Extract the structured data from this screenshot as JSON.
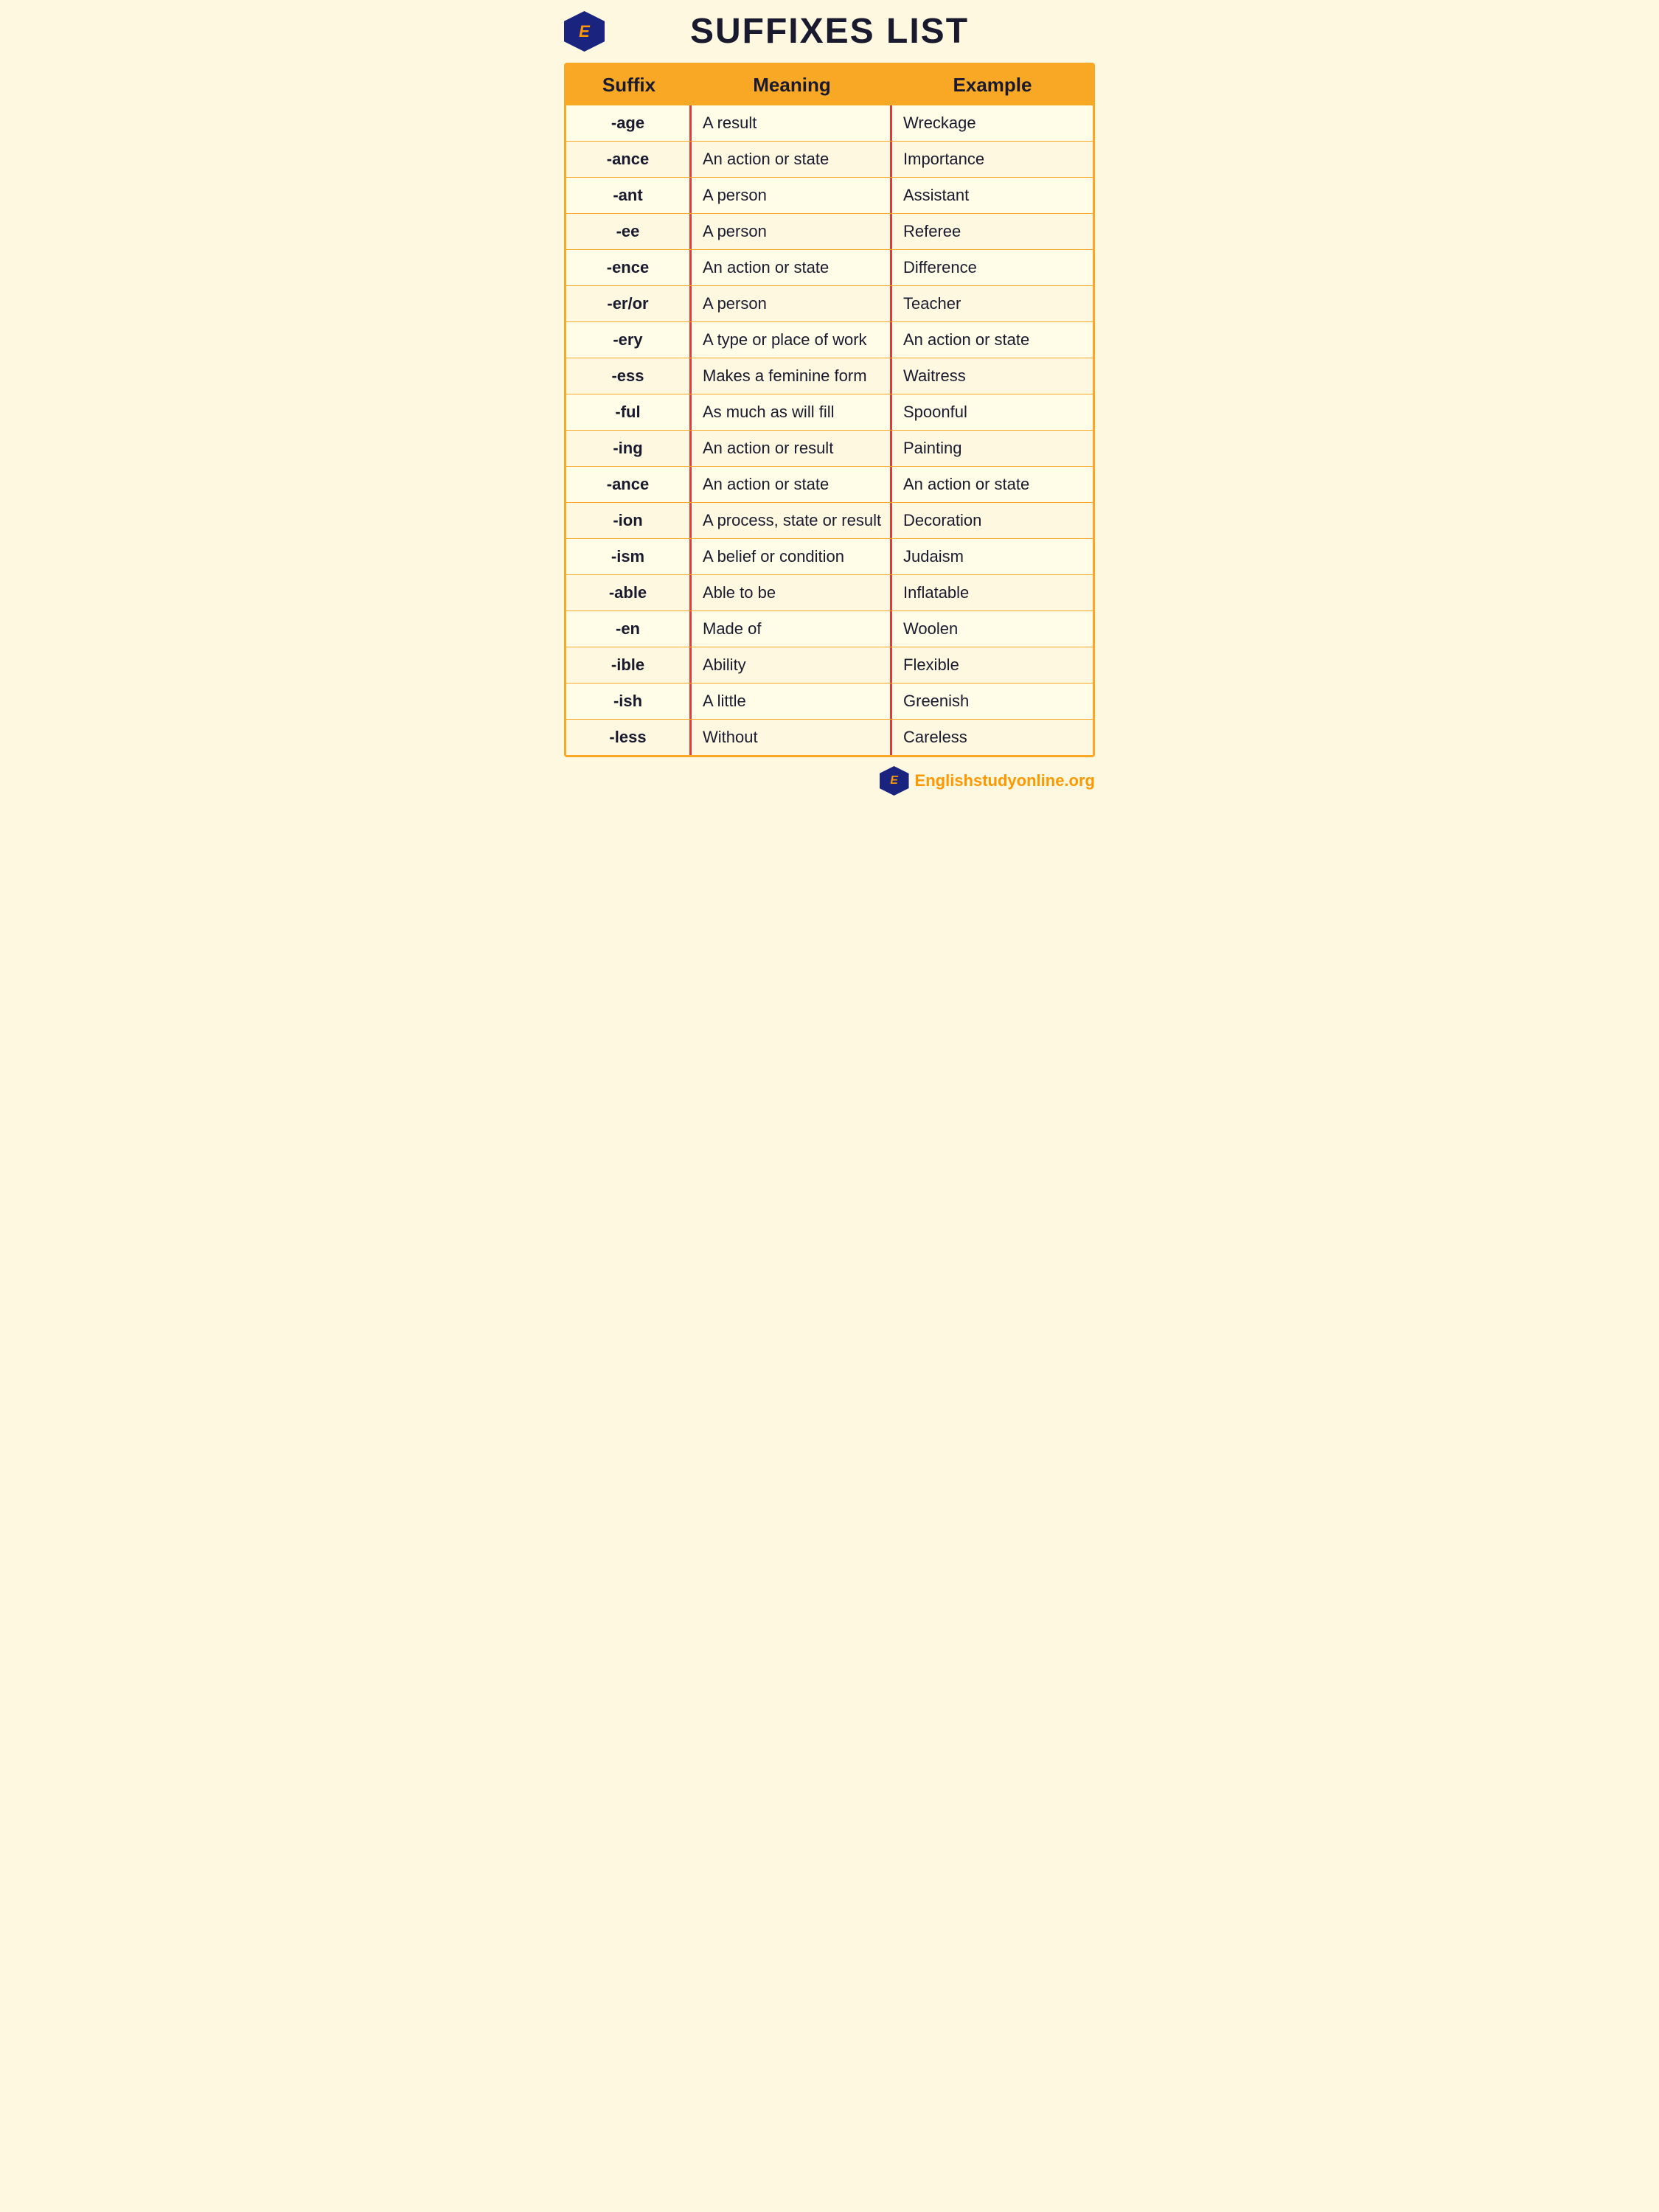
{
  "page": {
    "title": "SUFFIXES LIST",
    "logo_letter": "E",
    "footer_site": "nglishstudyonline.org",
    "footer_prefix": "E"
  },
  "table": {
    "headers": [
      "Suffix",
      "Meaning",
      "Example"
    ],
    "rows": [
      {
        "suffix": "-age",
        "meaning": "A result",
        "example": "Wreckage",
        "row_class": "even"
      },
      {
        "suffix": "-ance",
        "meaning": "An action or state",
        "example": "Importance",
        "row_class": "odd"
      },
      {
        "suffix": "-ant",
        "meaning": "A person",
        "example": "Assistant",
        "row_class": "even"
      },
      {
        "suffix": "-ee",
        "meaning": "A person",
        "example": "Referee",
        "row_class": "odd"
      },
      {
        "suffix": "-ence",
        "meaning": "An action or state",
        "example": "Difference",
        "row_class": "even"
      },
      {
        "suffix": "-er/or",
        "meaning": "A person",
        "example": "Teacher",
        "row_class": "odd"
      },
      {
        "suffix": "-ery",
        "meaning": "A type or place of work",
        "example": "An action or state",
        "row_class": "even"
      },
      {
        "suffix": "-ess",
        "meaning": "Makes a feminine form",
        "example": "Waitress",
        "row_class": "odd"
      },
      {
        "suffix": "-ful",
        "meaning": "As much as will fill",
        "example": "Spoonful",
        "row_class": "even"
      },
      {
        "suffix": "-ing",
        "meaning": "An action or result",
        "example": "Painting",
        "row_class": "odd"
      },
      {
        "suffix": "-ance",
        "meaning": "An action or state",
        "example": "An action or state",
        "row_class": "even"
      },
      {
        "suffix": "-ion",
        "meaning": "A process, state or result",
        "example": "Decoration",
        "row_class": "odd"
      },
      {
        "suffix": "-ism",
        "meaning": "A belief or condition",
        "example": "Judaism",
        "row_class": "even"
      },
      {
        "suffix": "-able",
        "meaning": "Able to be",
        "example": "Inflatable",
        "row_class": "odd"
      },
      {
        "suffix": "-en",
        "meaning": "Made of",
        "example": "Woolen",
        "row_class": "even"
      },
      {
        "suffix": "-ible",
        "meaning": "Ability",
        "example": "Flexible",
        "row_class": "odd"
      },
      {
        "suffix": "-ish",
        "meaning": "A little",
        "example": "Greenish",
        "row_class": "even"
      },
      {
        "suffix": "-less",
        "meaning": "Without",
        "example": "Careless",
        "row_class": "odd"
      }
    ]
  }
}
